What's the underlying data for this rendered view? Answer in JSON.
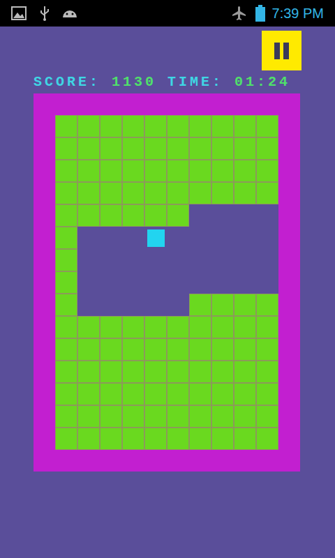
{
  "status_bar": {
    "time": "7:39 PM"
  },
  "hud": {
    "score_label": "SCORE:",
    "score": "1130",
    "time_label": "TIME:",
    "time": "01:24"
  },
  "board": {
    "rows": [
      [
        "block",
        "block",
        "block",
        "block",
        "block",
        "block",
        "block",
        "block",
        "block",
        "block"
      ],
      [
        "block",
        "block",
        "block",
        "block",
        "block",
        "block",
        "block",
        "block",
        "block",
        "block"
      ],
      [
        "block",
        "block",
        "block",
        "block",
        "block",
        "block",
        "block",
        "block",
        "block",
        "block"
      ],
      [
        "block",
        "block",
        "block",
        "block",
        "block",
        "block",
        "block",
        "block",
        "block",
        "block"
      ],
      [
        "block",
        "block",
        "block",
        "block",
        "block",
        "block",
        "empty",
        "empty",
        "empty",
        "empty"
      ],
      [
        "block",
        "empty",
        "empty",
        "empty",
        "player",
        "empty",
        "empty",
        "empty",
        "empty",
        "empty"
      ],
      [
        "block",
        "empty",
        "empty",
        "empty",
        "empty",
        "empty",
        "empty",
        "empty",
        "empty",
        "empty"
      ],
      [
        "block",
        "empty",
        "empty",
        "empty",
        "empty",
        "empty",
        "empty",
        "empty",
        "empty",
        "empty"
      ],
      [
        "block",
        "empty",
        "empty",
        "empty",
        "empty",
        "empty",
        "block",
        "block",
        "block",
        "block"
      ],
      [
        "block",
        "block",
        "block",
        "block",
        "block",
        "block",
        "block",
        "block",
        "block",
        "block"
      ],
      [
        "block",
        "block",
        "block",
        "block",
        "block",
        "block",
        "block",
        "block",
        "block",
        "block"
      ],
      [
        "block",
        "block",
        "block",
        "block",
        "block",
        "block",
        "block",
        "block",
        "block",
        "block"
      ],
      [
        "block",
        "block",
        "block",
        "block",
        "block",
        "block",
        "block",
        "block",
        "block",
        "block"
      ],
      [
        "block",
        "block",
        "block",
        "block",
        "block",
        "block",
        "block",
        "block",
        "block",
        "block"
      ],
      [
        "block",
        "block",
        "block",
        "block",
        "block",
        "block",
        "block",
        "block",
        "block",
        "block"
      ]
    ]
  }
}
